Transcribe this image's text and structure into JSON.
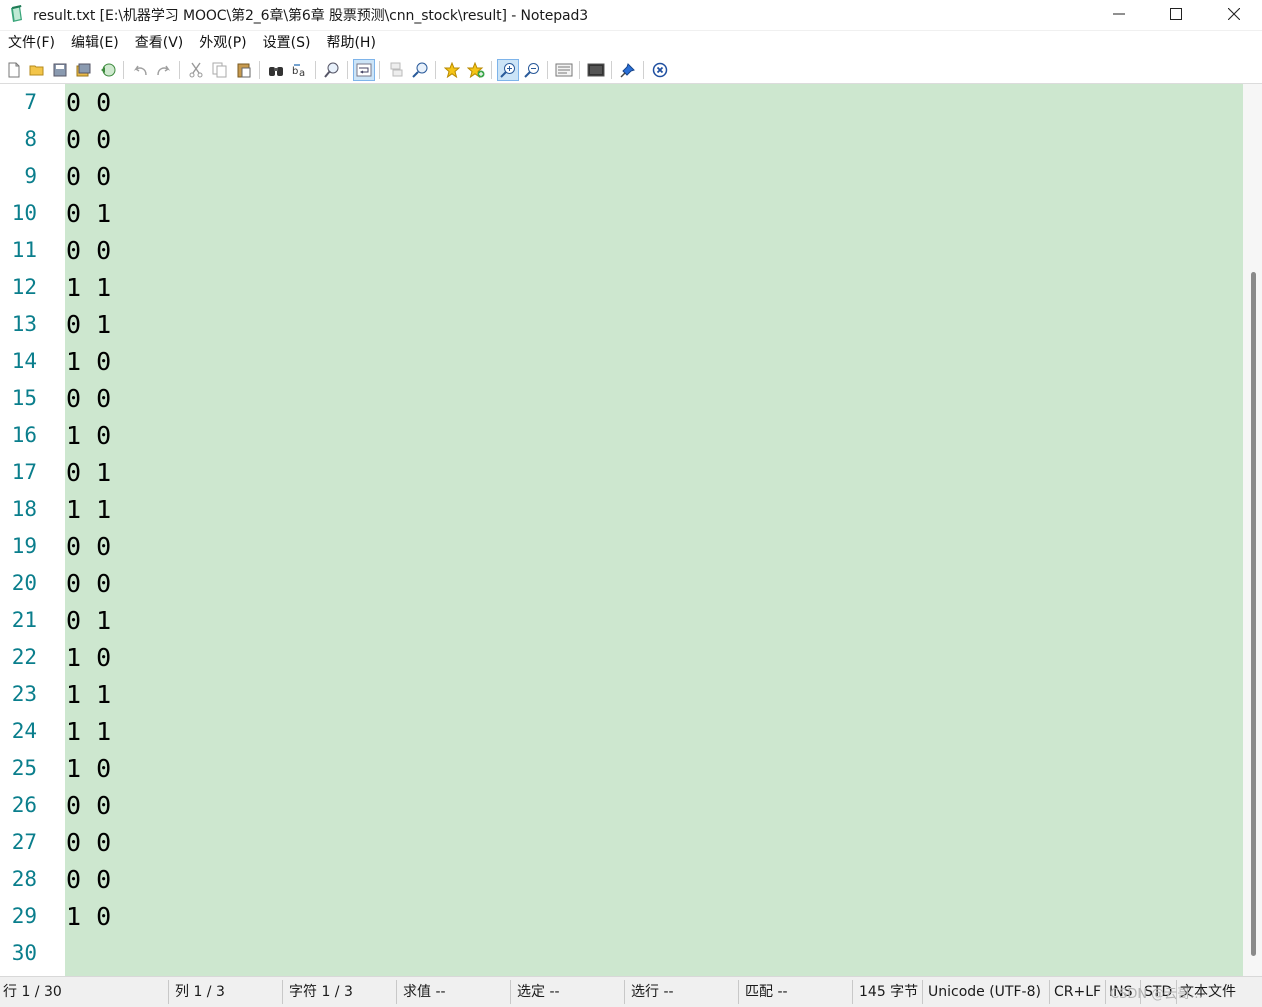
{
  "window": {
    "title": "result.txt [E:\\机器学习 MOOC\\第2_6章\\第6章 股票预测\\cnn_stock\\result] - Notepad3",
    "controls": [
      "minimize",
      "maximize",
      "close"
    ]
  },
  "menu": [
    "文件(F)",
    "编辑(E)",
    "查看(V)",
    "外观(P)",
    "设置(S)",
    "帮助(H)"
  ],
  "toolbar": {
    "icons": [
      "new-file-icon",
      "open-folder-icon",
      "save-icon",
      "save-as-icon",
      "revert-icon",
      "undo-icon",
      "redo-icon",
      "cut-icon",
      "copy-icon",
      "paste-icon",
      "find-icon",
      "replace-icon",
      "goto-icon",
      "word-wrap-icon",
      "mark-icon",
      "zoom-find-icon",
      "favorites-icon",
      "add-favorite-icon",
      "zoom-in-icon",
      "zoom-out-icon",
      "page-setup-icon",
      "screen-icon",
      "pin-icon",
      "exit-icon"
    ],
    "active": "word-wrap-icon"
  },
  "editor": {
    "background": "#cde7cf",
    "line_number_color": "#0a7e8c",
    "lines": [
      {
        "n": "7",
        "text": "0 0"
      },
      {
        "n": "8",
        "text": "0 0"
      },
      {
        "n": "9",
        "text": "0 0"
      },
      {
        "n": "10",
        "text": "0 1"
      },
      {
        "n": "11",
        "text": "0 0"
      },
      {
        "n": "12",
        "text": "1 1"
      },
      {
        "n": "13",
        "text": "0 1"
      },
      {
        "n": "14",
        "text": "1 0"
      },
      {
        "n": "15",
        "text": "0 0"
      },
      {
        "n": "16",
        "text": "1 0"
      },
      {
        "n": "17",
        "text": "0 1"
      },
      {
        "n": "18",
        "text": "1 1"
      },
      {
        "n": "19",
        "text": "0 0"
      },
      {
        "n": "20",
        "text": "0 0"
      },
      {
        "n": "21",
        "text": "0 1"
      },
      {
        "n": "22",
        "text": "1 0"
      },
      {
        "n": "23",
        "text": "1 1"
      },
      {
        "n": "24",
        "text": "1 1"
      },
      {
        "n": "25",
        "text": "1 0"
      },
      {
        "n": "26",
        "text": "0 0"
      },
      {
        "n": "27",
        "text": "0 0"
      },
      {
        "n": "28",
        "text": "0 0"
      },
      {
        "n": "29",
        "text": "1 0"
      },
      {
        "n": "30",
        "text": ""
      }
    ]
  },
  "status": {
    "line": "行  1 / 30",
    "column": "列  1 / 3",
    "char": "字符  1 / 3",
    "sum": "求值  --",
    "selection": "选定  --",
    "sel_lines": "选行  --",
    "match": "匹配  --",
    "size": "145 字节",
    "encoding": "Unicode (UTF-8)",
    "eol": "CR+LF",
    "ovr": "INS",
    "mode": "STD",
    "lexer": "文本文件",
    "watermark": "CSDN @云哥..."
  }
}
